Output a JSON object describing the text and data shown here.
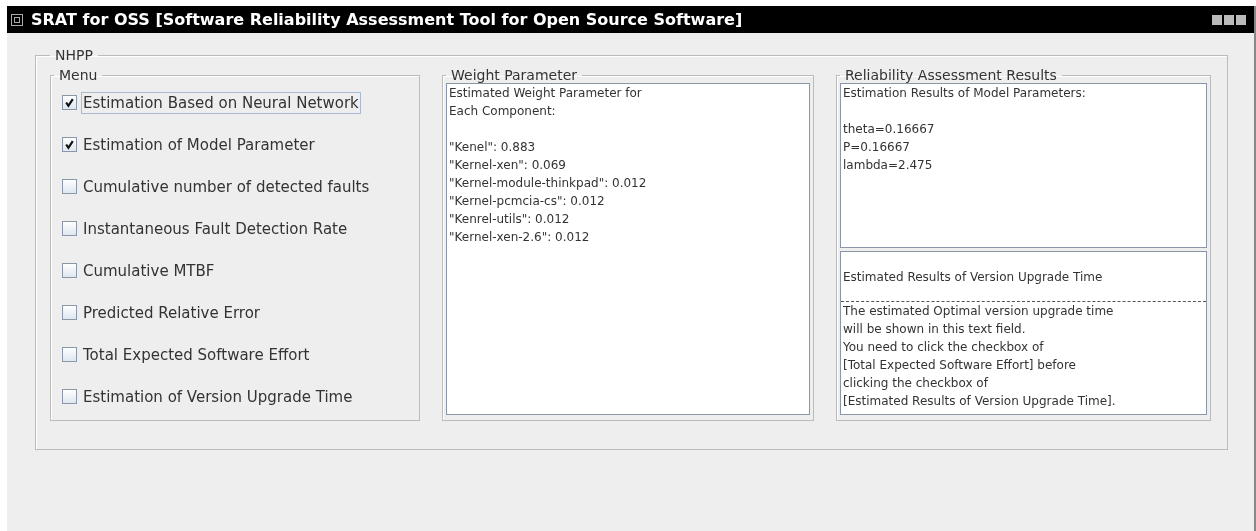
{
  "window": {
    "title": "SRAT for OSS [Software Reliability Assessment Tool for Open Source Software]"
  },
  "group": {
    "title": "NHPP"
  },
  "menu": {
    "title": "Menu",
    "items": [
      {
        "label": "Estimation Based on Neural Network",
        "checked": true,
        "focused": true
      },
      {
        "label": "Estimation of Model Parameter",
        "checked": true,
        "focused": false
      },
      {
        "label": "Cumulative number of detected faults",
        "checked": false,
        "focused": false
      },
      {
        "label": "Instantaneous Fault Detection Rate",
        "checked": false,
        "focused": false
      },
      {
        "label": "Cumulative MTBF",
        "checked": false,
        "focused": false
      },
      {
        "label": "Predicted Relative Error",
        "checked": false,
        "focused": false
      },
      {
        "label": "Total Expected Software Effort",
        "checked": false,
        "focused": false
      },
      {
        "label": "Estimation of Version Upgrade Time",
        "checked": false,
        "focused": false
      }
    ]
  },
  "weight": {
    "title": "Weight Parameter",
    "heading_lines": [
      "Estimated Weight Parameter for",
      "Each Component:"
    ],
    "lines": [
      "\"Kenel\": 0.883",
      "\"Kernel-xen\": 0.069",
      "\"Kernel-module-thinkpad\": 0.012",
      "\"Kernel-pcmcia-cs\": 0.012",
      "\"Kenrel-utils\": 0.012",
      "\"Kernel-xen-2.6\": 0.012"
    ]
  },
  "results": {
    "title": "Reliability Assessment Results",
    "model_heading": "Estimation Results of Model Parameters:",
    "model_lines": [
      "theta=0.16667",
      "P=0.16667",
      "lambda=2.475"
    ],
    "upgrade_heading": "Estimated Results of Version Upgrade Time",
    "upgrade_lines": [
      "The estimated Optimal version upgrade time",
      "will be shown in this text field.",
      "You need to click the checkbox of",
      "[Total Expected Software Effort] before",
      "clicking the checkbox of",
      "[Estimated Results of Version Upgrade Time]."
    ]
  }
}
